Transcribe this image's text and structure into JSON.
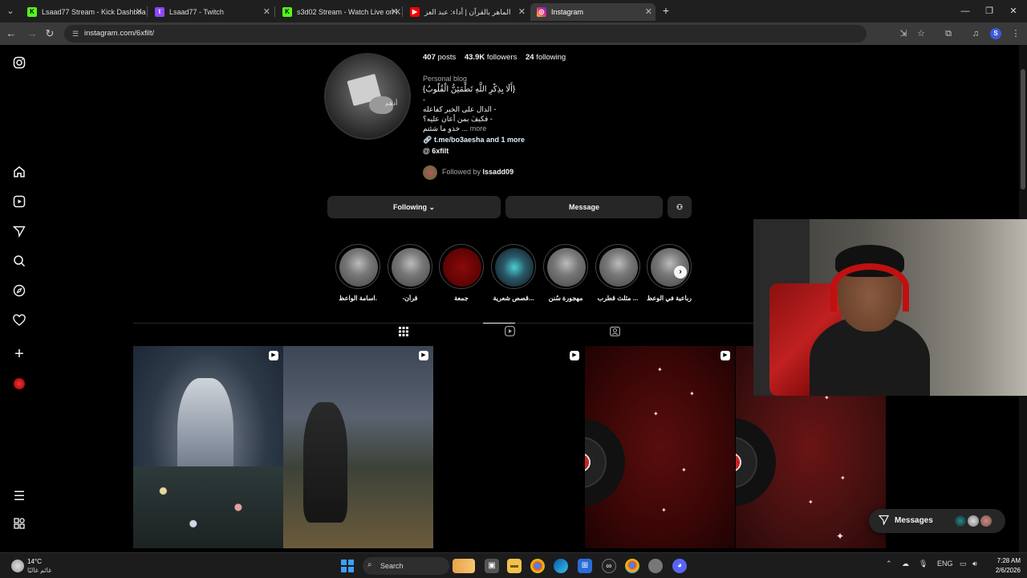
{
  "browser": {
    "tabs": [
      {
        "title": "Lsaad77 Stream - Kick Dashboa",
        "favicon": "kick-icon",
        "color": "#53fc18"
      },
      {
        "title": "Lsaad77 - Twitch",
        "favicon": "twitch-icon",
        "color": "#9146ff"
      },
      {
        "title": "s3d02 Stream - Watch Live on K",
        "favicon": "kick-icon",
        "color": "#53fc18"
      },
      {
        "title": "الماهر بالقرآن | أداء: عبد العز",
        "favicon": "youtube-icon",
        "color": "#ff0000"
      },
      {
        "title": "Instagram",
        "favicon": "instagram-icon",
        "color": "#e1306c"
      }
    ],
    "url": "instagram.com/6xfilt/"
  },
  "profile": {
    "posts_count": "407",
    "posts_label": "posts",
    "followers_count": "43.9K",
    "followers_label": "followers",
    "following_count": "24",
    "following_label": "following",
    "category": "Personal blog",
    "bio_lines": [
      "{أَلَا بِذِكْرِ اللَّهِ تَطْمَئِنُّ الْقُلُوبُ}",
      "-",
      "الدال على الخير كفاعله -",
      "فكيفَ بمن أعان عليه؟ -",
      "خذو ما شئتم ..."
    ],
    "bio_more": "more",
    "link": "t.me/bo3aesha and 1 more",
    "threads_handle": "6xfilt",
    "followed_by_label": "Followed by",
    "followed_by_user": "lssadd09",
    "avatar_signature": "أدهم"
  },
  "actions": {
    "following": "Following",
    "message": "Message"
  },
  "highlights": [
    {
      "label": "اسامة الواعظ."
    },
    {
      "label": "-قرآن"
    },
    {
      "label": "جمعة"
    },
    {
      "label": "قصص شعرية..."
    },
    {
      "label": "مهجورة سُنن"
    },
    {
      "label": "مثلث قطرب ..."
    },
    {
      "label": "رباعية في الوعظ"
    }
  ],
  "messages": {
    "label": "Messages"
  },
  "taskbar": {
    "weather_temp": "14°C",
    "weather_desc": "غائم غالبًا",
    "search": "Search",
    "lang": "ENG",
    "time": "7:28 AM",
    "date": "2/6/2026"
  }
}
